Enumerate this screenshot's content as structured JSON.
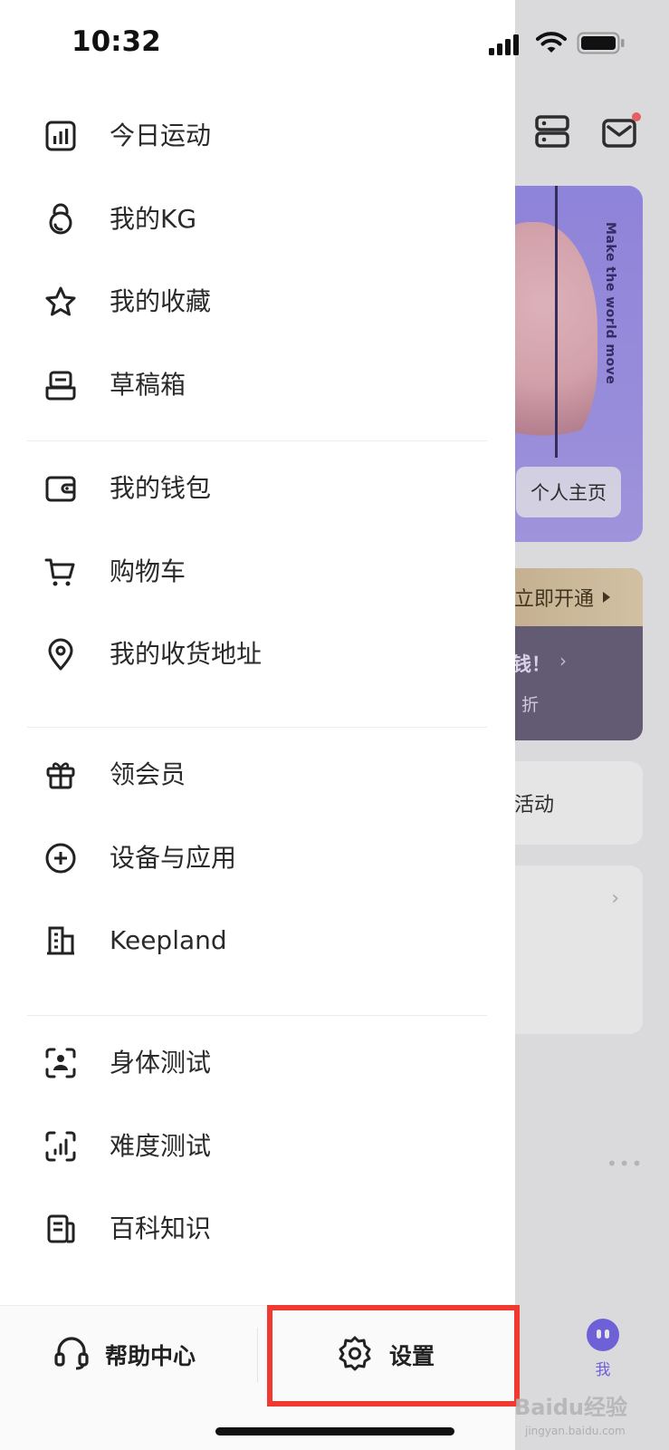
{
  "status_bar": {
    "time": "10:32"
  },
  "drawer": {
    "menu_groups": [
      [
        {
          "label": "今日运动",
          "icon": "chart-bars-icon"
        },
        {
          "label": "我的KG",
          "icon": "kettlebell-icon"
        },
        {
          "label": "我的收藏",
          "icon": "star-icon"
        },
        {
          "label": "草稿箱",
          "icon": "drafts-icon"
        }
      ],
      [
        {
          "label": "我的钱包",
          "icon": "wallet-icon"
        },
        {
          "label": "购物车",
          "icon": "cart-icon"
        },
        {
          "label": "我的收货地址",
          "icon": "location-pin-icon"
        }
      ],
      [
        {
          "label": "领会员",
          "icon": "gift-icon"
        },
        {
          "label": "设备与应用",
          "icon": "plus-circle-icon"
        },
        {
          "label": "Keepland",
          "icon": "building-icon"
        }
      ],
      [
        {
          "label": "身体测试",
          "icon": "body-scan-icon"
        },
        {
          "label": "难度测试",
          "icon": "difficulty-scan-icon"
        },
        {
          "label": "百科知识",
          "icon": "encyclopedia-icon"
        }
      ]
    ],
    "bottom": {
      "help_label": "帮助中心",
      "settings_label": "设置"
    }
  },
  "background_page": {
    "banner_slogan": "Make the world move",
    "profile_button": "个人主页",
    "vip_activate": "立即开通",
    "vip_promo_line1": "钱！",
    "vip_promo_line2": "折",
    "activity_label": "活动",
    "tab_me_label": "我"
  },
  "watermark": {
    "brand": "Baidu经验",
    "url": "jingyan.baidu.com"
  },
  "colors": {
    "accent": "#7b6df0",
    "highlight": "#f0392f",
    "banner": "#a99cf3",
    "vip_gold": "#e3cfa9"
  }
}
